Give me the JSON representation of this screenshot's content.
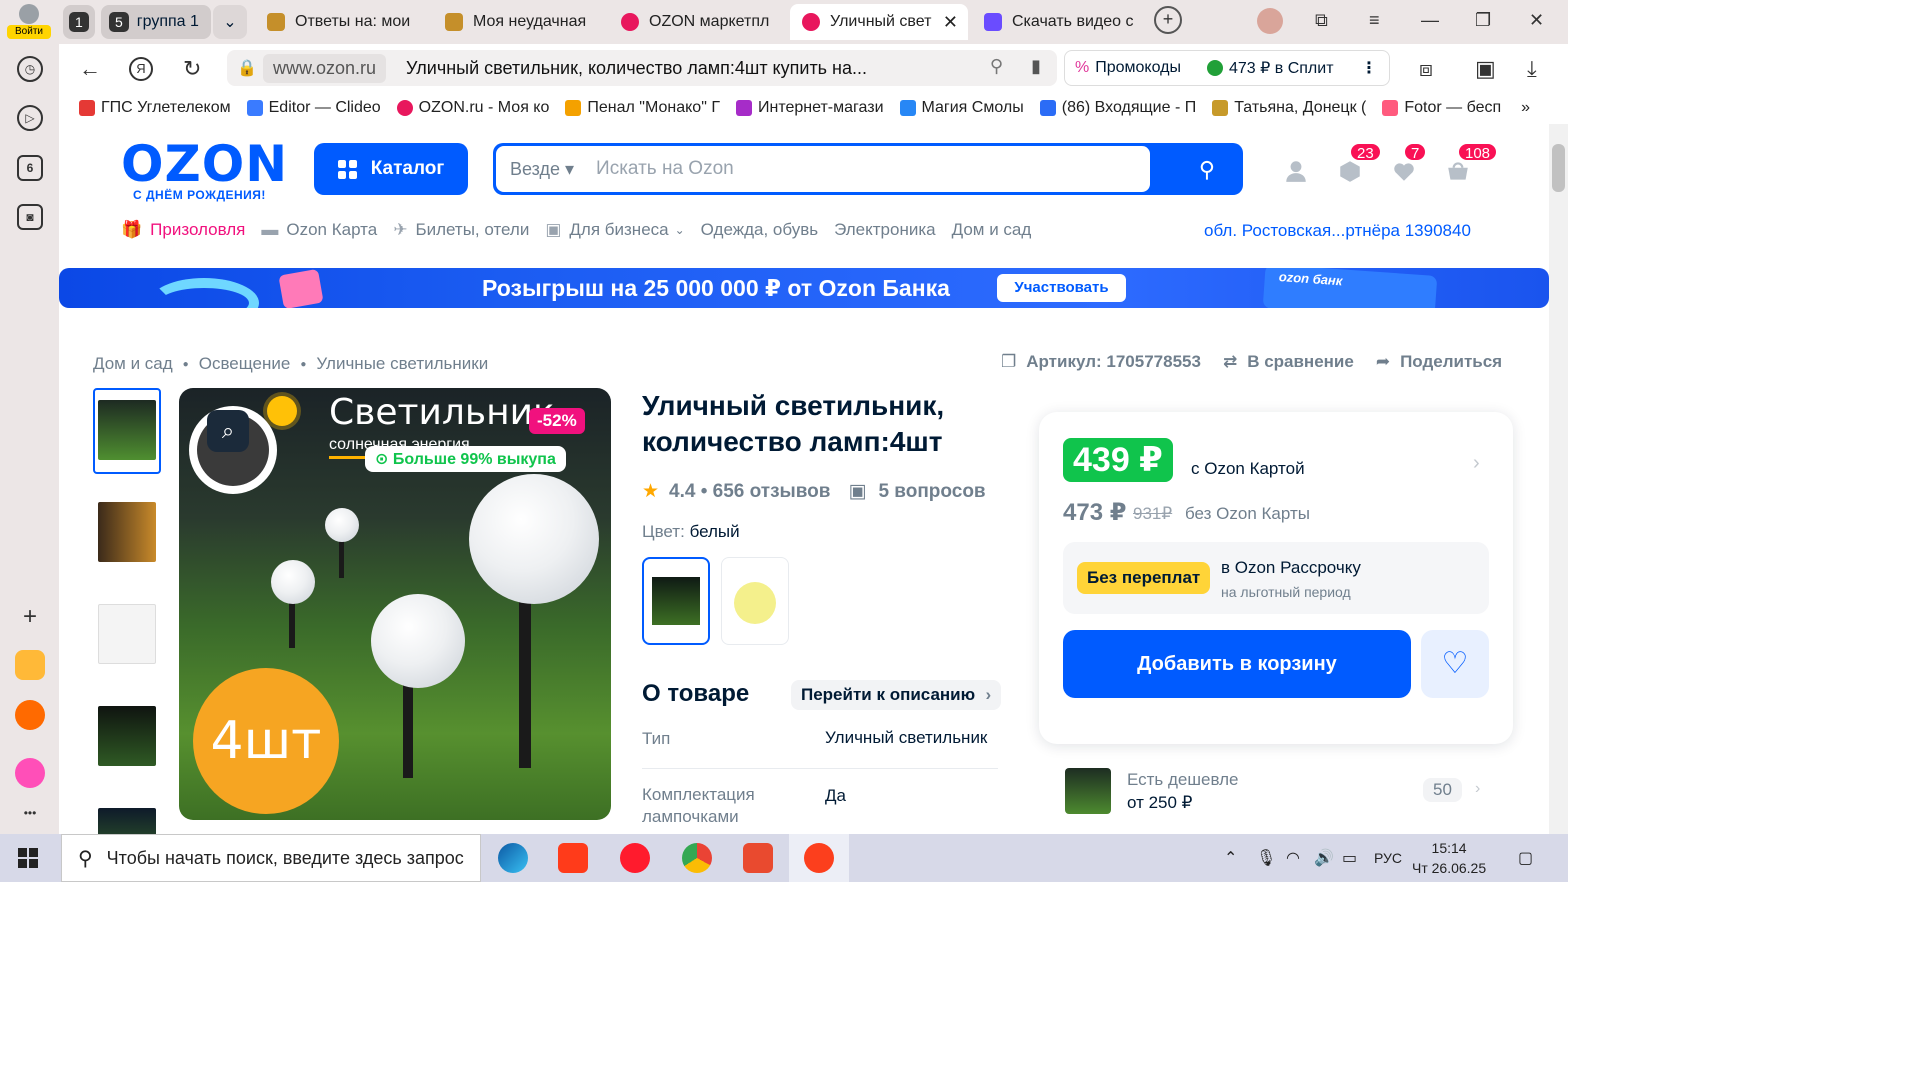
{
  "sidebar": {
    "login_label": "Войти",
    "badge_number": "6"
  },
  "tabs": {
    "group_count_small": "1",
    "group_count": "5",
    "group_label": "группа 1",
    "items": [
      {
        "label": "Ответы на: мои"
      },
      {
        "label": "Моя неудачная"
      },
      {
        "label": "OZON маркетпл"
      },
      {
        "label": "Уличный свет"
      },
      {
        "label": "Скачать видео с"
      }
    ]
  },
  "toolbar": {
    "domain": "www.ozon.ru",
    "page_title": "Уличный светильник, количество ламп:4шт купить на...",
    "promo_label": "Промокоды",
    "split_label": "473 ₽ в Сплит"
  },
  "bookmarks": [
    {
      "label": "ГПС Углетелеком",
      "color": "#e53935"
    },
    {
      "label": "Editor — Clideo",
      "color": "#3a7bff"
    },
    {
      "label": "OZON.ru - Моя ко",
      "color": "#e8175d"
    },
    {
      "label": "Пенал \"Монако\" Г",
      "color": "#f4a100"
    },
    {
      "label": "Интернет-магази",
      "color": "#a62cc8"
    },
    {
      "label": "Магия Смолы",
      "color": "#2787f5"
    },
    {
      "label": "(86) Входящие - П",
      "color": "#2b6cf6"
    },
    {
      "label": "Татьяна, Донецк (",
      "color": "#c79a2a"
    },
    {
      "label": "Fotor — бесп",
      "color": "#ff5b7e"
    }
  ],
  "header": {
    "logo": "OZON",
    "logo_tagline": "С ДНЁМ РОЖДЕНИЯ!",
    "catalog_label": "Каталог",
    "search_scope": "Везде",
    "search_placeholder": "Искать на Ozon",
    "badges": {
      "orders": "23",
      "favorites": "7",
      "cart": "108"
    }
  },
  "nav": {
    "items": [
      "Призоловля",
      "Ozon Карта",
      "Билеты, отели",
      "Для бизнеса",
      "Одежда, обувь",
      "Электроника",
      "Дом и сад"
    ],
    "region": "обл. Ростовская...ртнёра 1390840"
  },
  "banner": {
    "text": "Розыгрыш на 25 000 000 ₽ от Ozon Банка",
    "button": "Участвовать",
    "card_label": "ozon банк"
  },
  "product": {
    "breadcrumbs": [
      "Дом и сад",
      "Освещение",
      "Уличные светильники"
    ],
    "article": "Артикул: 1705778553",
    "compare": "В сравнение",
    "share": "Поделиться",
    "title": "Уличный светильник, количество ламп:4шт",
    "rating": "4.4 • 656 отзывов",
    "questions": "5 вопросов",
    "color_label": "Цвет:",
    "color_value": "белый",
    "image_heading": "Светильник",
    "image_subheading": "солнечная энергия",
    "discount": "-52%",
    "sold_badge": "Больше 99% выкупа",
    "quantity_badge": "4шт",
    "about_title": "О товаре",
    "goto_description": "Перейти к описанию",
    "specs": [
      {
        "key": "Тип",
        "value": "Уличный светильник"
      },
      {
        "key": "Комплектация лампочками",
        "value": "Да"
      }
    ]
  },
  "pricing": {
    "card_price": "439 ₽",
    "card_label": "с Ozon Картой",
    "price": "473 ₽",
    "old_price": "931₽",
    "no_card_label": "без Ozon Карты",
    "installment_tag": "Без переплат",
    "installment_title": "в Ozon Рассрочку",
    "installment_sub": "на льготный период",
    "add_to_cart": "Добавить в корзину",
    "cheaper_title": "Есть дешевле",
    "cheaper_price": "от 250 ₽",
    "cheaper_count": "50"
  },
  "taskbar": {
    "search_placeholder": "Чтобы начать поиск, введите здесь запрос",
    "lang": "РУС",
    "time": "15:14",
    "date": "Чт 26.06.25"
  },
  "colors": {
    "brand": "#005bff",
    "accent_pink": "#f1117e",
    "price_green": "#10c44c"
  }
}
